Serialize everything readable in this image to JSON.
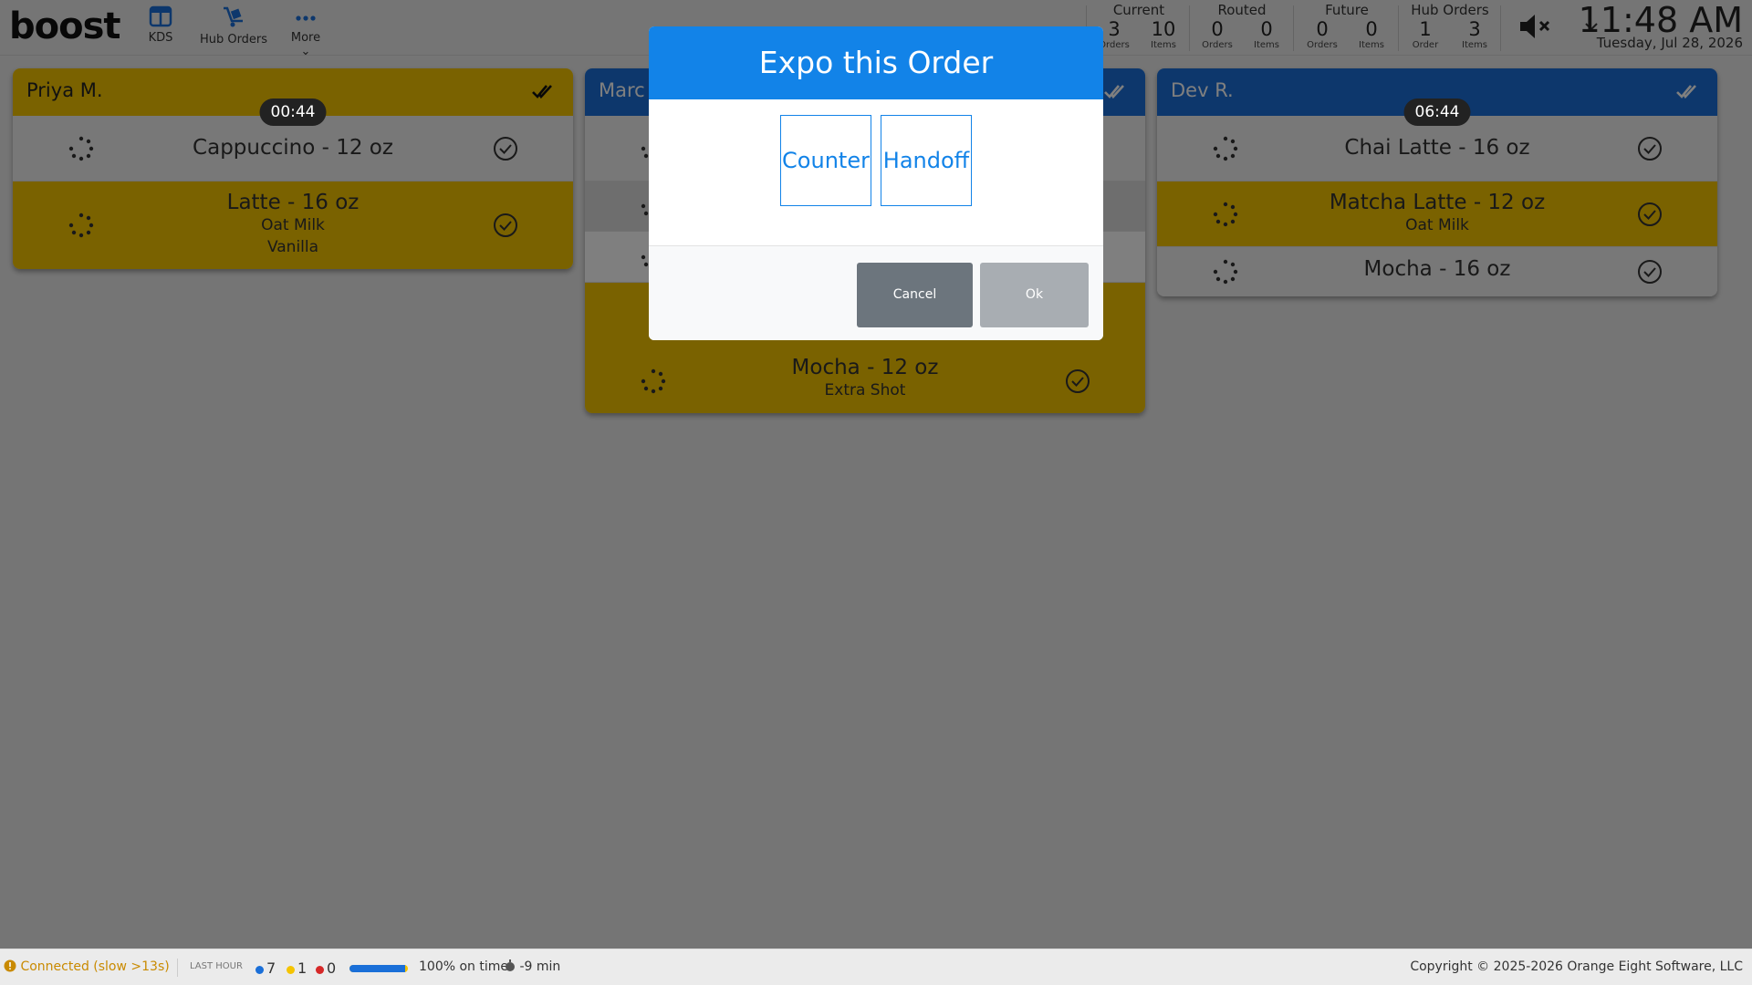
{
  "app": {
    "logo": "boost"
  },
  "nav": [
    {
      "label": "KDS",
      "icon": "kds-icon"
    },
    {
      "label": "Hub Orders",
      "icon": "hub-orders-icon"
    },
    {
      "label": "More ⌄",
      "icon": "more-icon"
    }
  ],
  "stats": {
    "current": {
      "title": "Current",
      "orders": "3",
      "orders_label": "Orders",
      "items": "10",
      "items_label": "Items"
    },
    "routed": {
      "title": "Routed",
      "orders": "0",
      "orders_label": "Orders",
      "items": "0",
      "items_label": "Items"
    },
    "future": {
      "title": "Future",
      "orders": "0",
      "orders_label": "Orders",
      "items": "0",
      "items_label": "Items"
    },
    "hub": {
      "title": "Hub Orders",
      "orders": "1",
      "orders_label": "Order",
      "items": "3",
      "items_label": "Items"
    }
  },
  "header": {
    "time": "11:48 AM",
    "date": "Tuesday, Jul 28, 2026",
    "mute_icon": "speaker-muted-icon"
  },
  "orders": [
    {
      "name": "Priya M.",
      "timer": "00:44",
      "header_color": "#f5c400",
      "items": [
        {
          "title": "Cappuccino - 12 oz",
          "mods": []
        },
        {
          "title": "Latte - 16 oz",
          "mods": [
            "Oat Milk",
            "Vanilla"
          ]
        }
      ]
    },
    {
      "name": "Marc",
      "timer": "",
      "header_color": "#1a6fd8",
      "items": [
        {
          "title": "Mocha - 12 oz",
          "mods": [
            "Extra Shot"
          ]
        }
      ]
    },
    {
      "name": "Dev R.",
      "timer": "06:44",
      "header_color": "#1a6fd8",
      "items": [
        {
          "title": "Chai Latte - 16 oz",
          "mods": []
        },
        {
          "title": "Matcha Latte - 12 oz",
          "mods": [
            "Oat Milk"
          ]
        },
        {
          "title": "Mocha - 16 oz",
          "mods": []
        }
      ]
    }
  ],
  "modal": {
    "title": "Expo this Order",
    "options": [
      "Counter",
      "Handoff"
    ],
    "cancel_label": "Cancel",
    "ok_label": "Ok"
  },
  "footer": {
    "status": "Connected (slow >13s)",
    "last_hour_label": "LAST HOUR",
    "count_blue": "7",
    "count_yellow": "1",
    "count_red": "0",
    "on_time_fraction": 0.95,
    "on_time": "100% on time",
    "avg": "-9 min",
    "copyright": "Copyright © 2025-2026 Orange Eight Software, LLC"
  },
  "colors": {
    "accent": "#1283e8",
    "yellow": "#f5c400",
    "blue": "#1a6fd8",
    "red": "#d62828"
  }
}
